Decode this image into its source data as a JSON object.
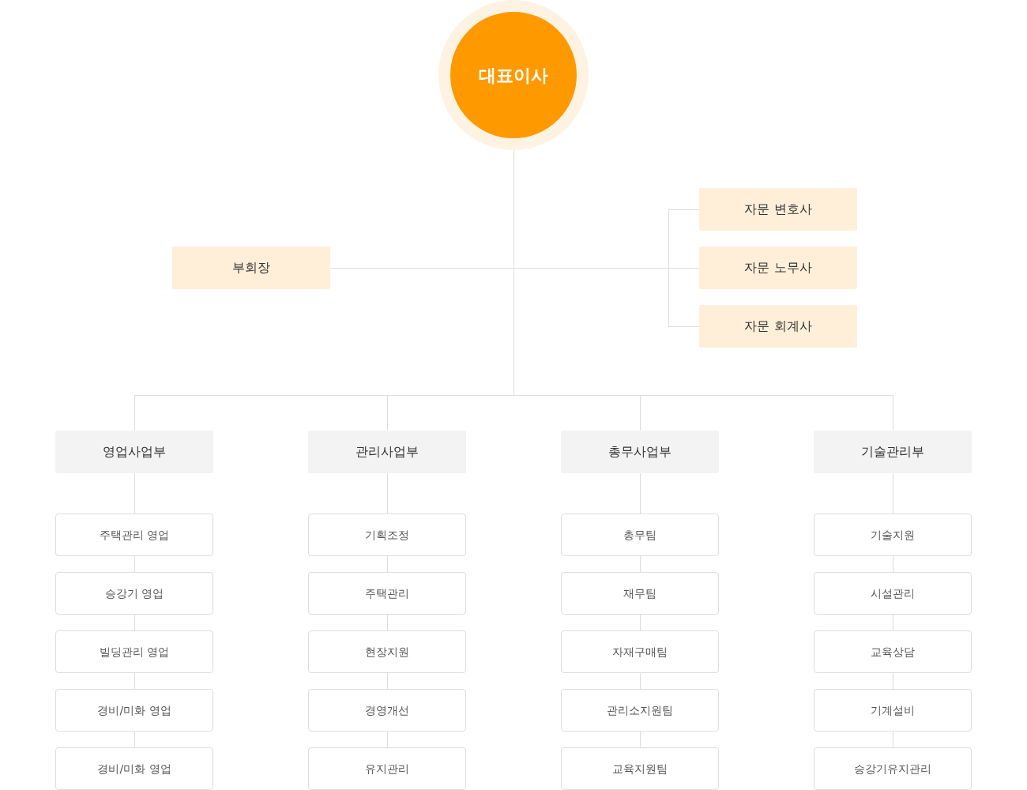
{
  "ceo": {
    "title": "대표이사"
  },
  "vice_chair": {
    "title": "부회장"
  },
  "advisors": [
    {
      "title": "자문 변호사"
    },
    {
      "title": "자문 노무사"
    },
    {
      "title": "자문 회계사"
    }
  ],
  "departments": [
    {
      "title": "영업사업부",
      "teams": [
        "주택관리 영업",
        "승강기 영업",
        "빌딩관리 영업",
        "경비/미화 영업",
        "경비/미화 영업"
      ]
    },
    {
      "title": "관리사업부",
      "teams": [
        "기획조정",
        "주택관리",
        "현장지원",
        "경영개선",
        "유지관리"
      ]
    },
    {
      "title": "총무사업부",
      "teams": [
        "총무팀",
        "재무팀",
        "자재구매팀",
        "관리소지원팀",
        "교육지원팀"
      ]
    },
    {
      "title": "기술관리부",
      "teams": [
        "기술지원",
        "시설관리",
        "교육상담",
        "기계설비",
        "승강기유지관리"
      ]
    }
  ]
}
